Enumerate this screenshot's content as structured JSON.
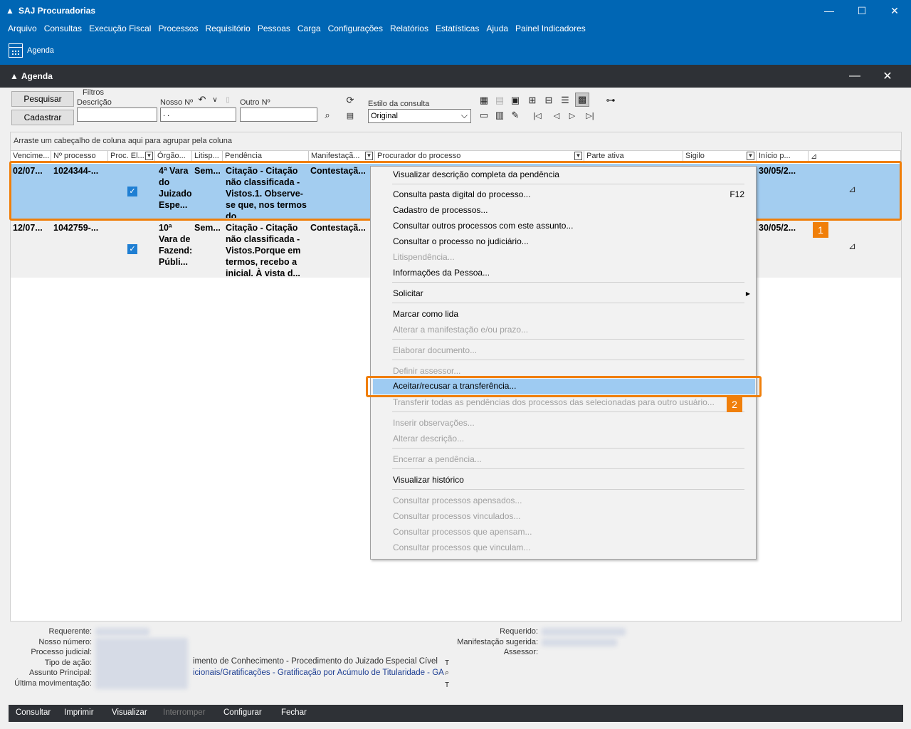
{
  "app": {
    "title": "SAJ Procuradorias",
    "window_buttons": {
      "minimize": "—",
      "maximize": "☐",
      "close": "✕"
    }
  },
  "menu": [
    "Arquivo",
    "Consultas",
    "Execução Fiscal",
    "Processos",
    "Requisitório",
    "Pessoas",
    "Carga",
    "Configurações",
    "Relatórios",
    "Estatísticas",
    "Ajuda",
    "Painel Indicadores"
  ],
  "toolbar": {
    "agenda_label": "Agenda"
  },
  "child_window": {
    "title": "Agenda",
    "minimize": "—",
    "close": "✕"
  },
  "filters": {
    "pesquisar": "Pesquisar",
    "cadastrar": "Cadastrar",
    "group_title": "Filtros",
    "descricao_label": "Descrição",
    "nosso_label": "Nosso Nº",
    "nosso_value": ". .",
    "outro_label": "Outro Nº",
    "estilo_label": "Estilo da consulta",
    "estilo_value": "Original"
  },
  "grid": {
    "group_hint": "Arraste um cabeçalho de coluna aqui para agrupar pela coluna",
    "columns": [
      "Vencime...",
      "Nº processo",
      "Proc. El...",
      "Órgão...",
      "Litisp...",
      "Pendência",
      "Manifestaçã...",
      "Procurador do processo",
      "Parte ativa",
      "Sigilo",
      "Início p..."
    ],
    "rows": [
      {
        "vencimento": "02/07...",
        "processo": "1024344-...",
        "orgao": "4ª Vara do Juizado Espe...",
        "litisp": "Sem...",
        "pendencia": "Citação - Citação não classificada - Vistos.1. Observe-se que, nos termos do ...",
        "manifestacao": "Contestaçã...",
        "inicio": "30/05/2..."
      },
      {
        "vencimento": "12/07...",
        "processo": "1042759-...",
        "orgao": "10ª Vara de Fazend: Públi...",
        "litisp": "Sem...",
        "pendencia": "Citação - Citação não classificada - Vistos.Porque em termos, recebo a inicial. À vista d...",
        "manifestacao": "Contestaçã...",
        "inicio": "30/05/2..."
      }
    ]
  },
  "callouts": {
    "one": "1",
    "two": "2"
  },
  "context_menu": {
    "items": [
      {
        "label": "Visualizar descrição completa da pendência",
        "disabled": false
      },
      {
        "label": "Consulta pasta digital do processo...",
        "shortcut": "F12",
        "disabled": false
      },
      {
        "label": "Cadastro de processos...",
        "disabled": false
      },
      {
        "label": "Consultar outros processos com este assunto...",
        "disabled": false
      },
      {
        "label": "Consultar o processo no judiciário...",
        "disabled": false
      },
      {
        "label": "Litispendência...",
        "disabled": true
      },
      {
        "label": "Informações da Pessoa...",
        "disabled": false
      },
      {
        "label": "Solicitar",
        "disabled": false
      },
      {
        "label": "Marcar como lida",
        "disabled": false
      },
      {
        "label": "Alterar a manifestação e/ou prazo...",
        "disabled": true
      },
      {
        "label": "Elaborar documento...",
        "disabled": true
      },
      {
        "label": "Definir assessor...",
        "disabled": true
      },
      {
        "label": "Aceitar/recusar a transferência...",
        "disabled": false
      },
      {
        "label": "Transferir todas as pendências dos processos das selecionadas para outro usuário...",
        "disabled": true
      },
      {
        "label": "Inserir observações...",
        "disabled": true
      },
      {
        "label": "Alterar descrição...",
        "disabled": true
      },
      {
        "label": "Encerrar a pendência...",
        "disabled": true
      },
      {
        "label": "Visualizar histórico",
        "disabled": false
      },
      {
        "label": "Consultar processos apensados...",
        "disabled": true
      },
      {
        "label": "Consultar processos vinculados...",
        "disabled": true
      },
      {
        "label": "Consultar processos que apensam...",
        "disabled": true
      },
      {
        "label": "Consultar processos que vinculam...",
        "disabled": true
      }
    ]
  },
  "details": {
    "requerente": "Requerente:",
    "nosso_numero": "Nosso número:",
    "processo_judicial": "Processo judicial:",
    "tipo_acao": "Tipo de ação:",
    "assunto_principal": "Assunto Principal:",
    "ultima_mov": "Última movimentação:",
    "tipo_acao_value": "imento de Conhecimento - Procedimento do Juizado Especial Cível",
    "assunto_value": "icionais/Gratificações - Gratificação por Acúmulo de Titularidade - GA",
    "requerido": "Requerido:",
    "manifestacao_sugerida": "Manifestação sugerida:",
    "assessor": "Assessor:"
  },
  "bottom": [
    "Consultar",
    "Imprimir",
    "Visualizar",
    "Interromper",
    "Configurar",
    "Fechar"
  ]
}
